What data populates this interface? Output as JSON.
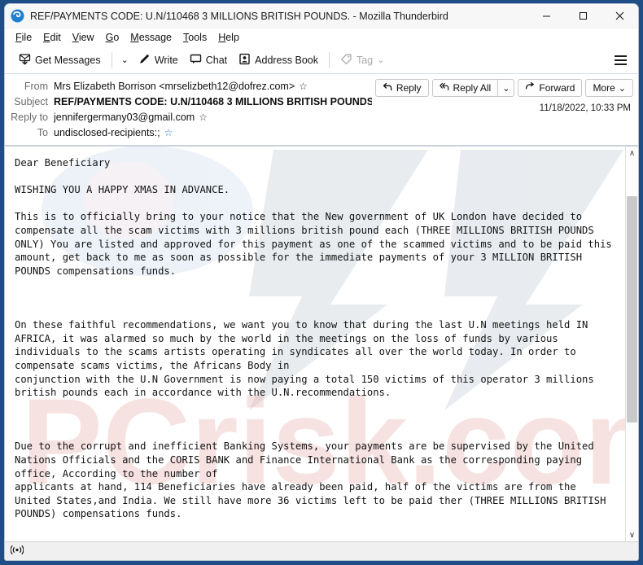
{
  "window": {
    "title": "REF/PAYMENTS CODE: U.N/110468 3 MILLIONS BRITISH POUNDS. - Mozilla Thunderbird",
    "logo_icon": "thunderbird-logo-icon",
    "controls": {
      "minimize": "—",
      "maximize": "□",
      "close": "✕"
    },
    "border_color": "#1f4e86"
  },
  "menubar": {
    "items": [
      {
        "label": "File",
        "accel": "F",
        "rest": "ile"
      },
      {
        "label": "Edit",
        "accel": "E",
        "rest": "dit"
      },
      {
        "label": "View",
        "accel": "V",
        "rest": "iew"
      },
      {
        "label": "Go",
        "accel": "G",
        "rest": "o"
      },
      {
        "label": "Message",
        "accel": "M",
        "rest": "essage"
      },
      {
        "label": "Tools",
        "accel": "T",
        "rest": "ools"
      },
      {
        "label": "Help",
        "accel": "H",
        "rest": "elp"
      }
    ]
  },
  "toolbar": {
    "get_messages": "Get Messages",
    "get_messages_caret": "⌄",
    "write": "Write",
    "chat": "Chat",
    "address_book": "Address Book",
    "tag": "Tag",
    "tag_caret": "⌄",
    "menu_button": "app-menu"
  },
  "message": {
    "rows": [
      {
        "label": "From",
        "value": "Mrs Elizabeth Borrison <mrselizbeth12@dofrez.com>",
        "star": "☆",
        "star_color": "dark",
        "bold": false
      },
      {
        "label": "Subject",
        "value": "REF/PAYMENTS CODE: U.N/110468 3 MILLIONS BRITISH POUNDS.",
        "star": "",
        "star_color": "none",
        "bold": true
      },
      {
        "label": "Reply to",
        "value": "jennifergermany03@gmail.com",
        "star": "☆",
        "star_color": "dark",
        "bold": false
      },
      {
        "label": "To",
        "value": "undisclosed-recipients:;",
        "star": "☆",
        "star_color": "blue",
        "bold": false
      }
    ],
    "date": "11/18/2022, 10:33 PM",
    "actions": {
      "reply": "Reply",
      "reply_all": "Reply All",
      "reply_all_caret": "⌄",
      "forward": "Forward",
      "more": "More",
      "more_caret": "⌄"
    },
    "body": "Dear Beneficiary\n\nWISHING YOU A HAPPY XMAS IN ADVANCE.\n\nThis is to officially bring to your notice that the New government of UK London have decided to compensate all the scam victims with 3 millions british pound each (THREE MILLIONS BRITISH POUNDS ONLY) You are listed and approved for this payment as one of the scammed victims and to be paid this amount, get back to me as soon as possible for the immediate payments of your 3 MILLION BRITISH POUNDS compensations funds.\n\n\n\nOn these faithful recommendations, we want you to know that during the last U.N meetings held IN AFRICA, it was alarmed so much by the world in the meetings on the loss of funds by various individuals to the scams artists operating in syndicates all over the world today. In order to compensate scams victims, the Africans Body in\nconjunction with the U.N Government is now paying a total 150 victims of this operator 3 millions british pounds each in accordance with the U.N.recommendations.\n\n\n\nDue to the corrupt and inefficient Banking Systems, your payments are be supervised by the United Nations Officials and the CORIS BANK and Finance International Bank as the corresponding paying office, According to the number of\napplicants at hand, 114 Beneficiaries have already been paid, half of the victims are from the United States,and India. We still have more 36 victims left to be paid ther (THREE MILLIONS BRITISH POUNDS) compensations funds."
  },
  "scrollbar": {
    "up_arrow": "∧",
    "down_arrow": "∨"
  },
  "statusbar": {
    "icon": "broadcast-icon",
    "icon_glyph": "((•))",
    "text": ""
  }
}
